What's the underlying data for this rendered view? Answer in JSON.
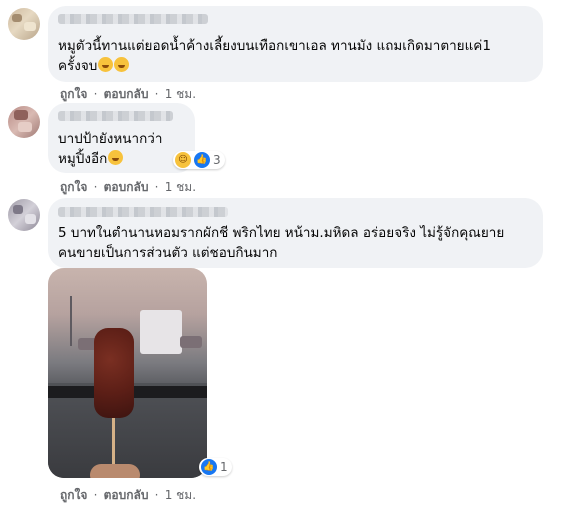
{
  "comments": [
    {
      "text_lines": [
        "หมูตัวนี้ทานแต่ยอดน้ำค้างเลี้ยงบนเทือกเขาเอล ทานมัง แถมเกิดมาตายแค่1",
        "ครั้งจบ"
      ],
      "emojis": [
        "rofl-emoji",
        "rofl-emoji"
      ],
      "actions": {
        "like": "ถูกใจ",
        "reply": "ตอบกลับ",
        "time": "1 ชม."
      }
    },
    {
      "text_lines": [
        "บาปป้ายังหนากว่า",
        "หมูปิ้งอีก"
      ],
      "emojis": [
        "laugh-emoji"
      ],
      "reactions": {
        "icons": [
          "haha-icon",
          "like-icon"
        ],
        "count": "3"
      },
      "actions": {
        "like": "ถูกใจ",
        "reply": "ตอบกลับ",
        "time": "1 ชม."
      }
    },
    {
      "text_lines": [
        "5 บาทในตำนานหอมรากผักชี พริกไทย หน้าม.มหิดล อร่อยจริง ไม่รู้จักคุณยาย",
        "คนขายเป็นการส่วนตัว แต่ชอบกินมาก"
      ],
      "photo_reactions": {
        "icons": [
          "like-icon"
        ],
        "count": "1"
      },
      "actions": {
        "like": "ถูกใจ",
        "reply": "ตอบกลับ",
        "time": "1 ชม."
      }
    }
  ],
  "separator": "·",
  "colors": {
    "bubble": "#f0f2f5",
    "meta": "#65676b",
    "like_blue": "#1877f2",
    "haha_yellow": "#f7c23c"
  }
}
